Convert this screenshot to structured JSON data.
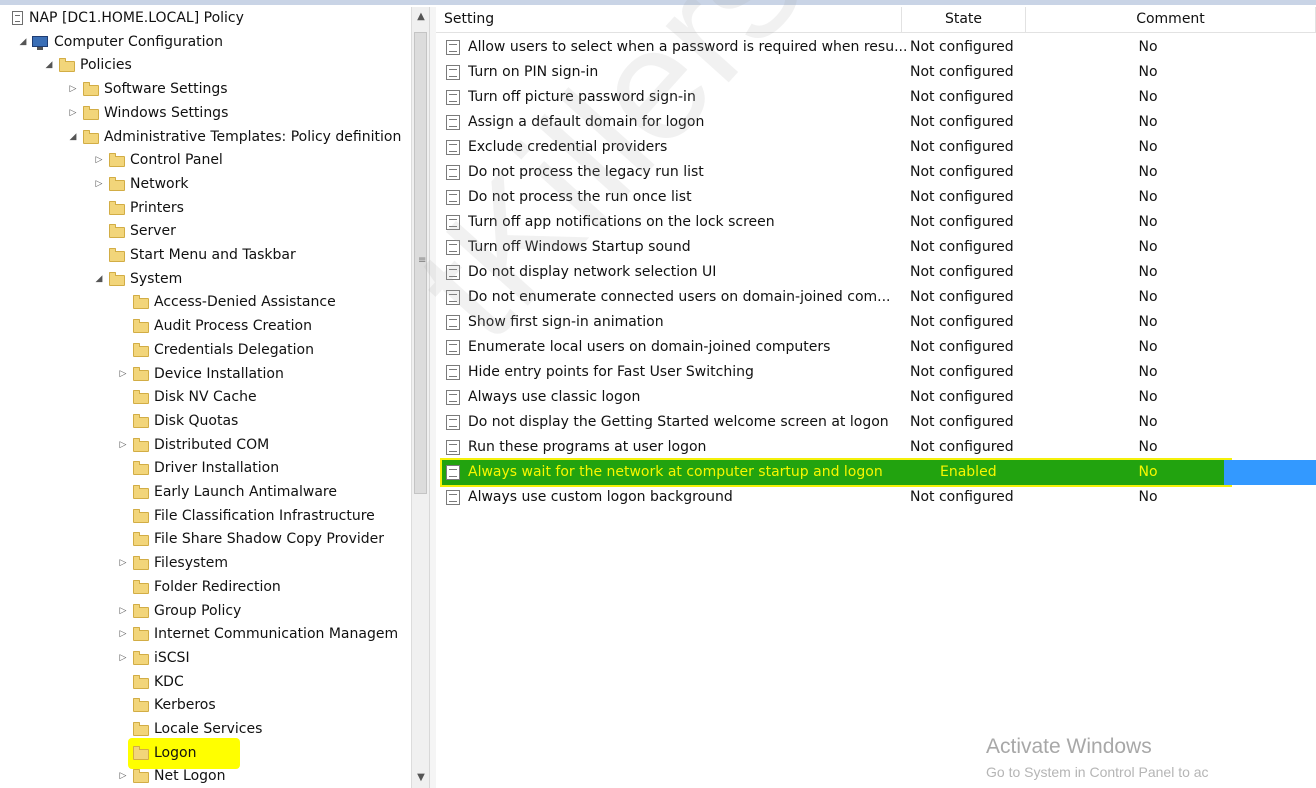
{
  "tree": {
    "root": {
      "label": "NAP [DC1.HOME.LOCAL] Policy",
      "icon": "policy-document-icon"
    },
    "nodes": [
      {
        "label": "Computer Configuration",
        "expander": "expanded",
        "icon": "computer-icon"
      },
      {
        "label": "Policies",
        "expander": "expanded",
        "icon": "folder-icon"
      },
      {
        "label": "Software Settings",
        "expander": "collapsed",
        "icon": "folder-icon"
      },
      {
        "label": "Windows Settings",
        "expander": "collapsed",
        "icon": "folder-icon"
      },
      {
        "label": "Administrative Templates: Policy definition",
        "expander": "expanded",
        "icon": "folder-icon"
      },
      {
        "label": "Control Panel",
        "expander": "collapsed",
        "icon": "folder-icon"
      },
      {
        "label": "Network",
        "expander": "collapsed",
        "icon": "folder-icon"
      },
      {
        "label": "Printers",
        "expander": "none",
        "icon": "folder-icon"
      },
      {
        "label": "Server",
        "expander": "none",
        "icon": "folder-icon"
      },
      {
        "label": "Start Menu and Taskbar",
        "expander": "none",
        "icon": "folder-icon"
      },
      {
        "label": "System",
        "expander": "expanded",
        "icon": "folder-icon"
      },
      {
        "label": "Access-Denied Assistance",
        "expander": "none",
        "icon": "folder-icon"
      },
      {
        "label": "Audit Process Creation",
        "expander": "none",
        "icon": "folder-icon"
      },
      {
        "label": "Credentials Delegation",
        "expander": "none",
        "icon": "folder-icon"
      },
      {
        "label": "Device Installation",
        "expander": "collapsed",
        "icon": "folder-icon"
      },
      {
        "label": "Disk NV Cache",
        "expander": "none",
        "icon": "folder-icon"
      },
      {
        "label": "Disk Quotas",
        "expander": "none",
        "icon": "folder-icon"
      },
      {
        "label": "Distributed COM",
        "expander": "collapsed",
        "icon": "folder-icon"
      },
      {
        "label": "Driver Installation",
        "expander": "none",
        "icon": "folder-icon"
      },
      {
        "label": "Early Launch Antimalware",
        "expander": "none",
        "icon": "folder-icon"
      },
      {
        "label": "File Classification Infrastructure",
        "expander": "none",
        "icon": "folder-icon"
      },
      {
        "label": "File Share Shadow Copy Provider",
        "expander": "none",
        "icon": "folder-icon"
      },
      {
        "label": "Filesystem",
        "expander": "collapsed",
        "icon": "folder-icon"
      },
      {
        "label": "Folder Redirection",
        "expander": "none",
        "icon": "folder-icon"
      },
      {
        "label": "Group Policy",
        "expander": "collapsed",
        "icon": "folder-icon"
      },
      {
        "label": "Internet Communication Managem",
        "expander": "collapsed",
        "icon": "folder-icon"
      },
      {
        "label": "iSCSI",
        "expander": "collapsed",
        "icon": "folder-icon"
      },
      {
        "label": "KDC",
        "expander": "none",
        "icon": "folder-icon"
      },
      {
        "label": "Kerberos",
        "expander": "none",
        "icon": "folder-icon"
      },
      {
        "label": "Locale Services",
        "expander": "none",
        "icon": "folder-icon"
      },
      {
        "label": "Logon",
        "expander": "none",
        "icon": "folder-icon",
        "highlight": "#ffff00"
      },
      {
        "label": "Net Logon",
        "expander": "collapsed",
        "icon": "folder-icon"
      }
    ]
  },
  "list": {
    "columns": [
      "Setting",
      "State",
      "Comment"
    ],
    "rows": [
      {
        "setting": "Allow users to select when a password is required when resu...",
        "state": "Not configured",
        "comment": "No"
      },
      {
        "setting": "Turn on PIN sign-in",
        "state": "Not configured",
        "comment": "No"
      },
      {
        "setting": "Turn off picture password sign-in",
        "state": "Not configured",
        "comment": "No"
      },
      {
        "setting": "Assign a default domain for logon",
        "state": "Not configured",
        "comment": "No"
      },
      {
        "setting": "Exclude credential providers",
        "state": "Not configured",
        "comment": "No"
      },
      {
        "setting": "Do not process the legacy run list",
        "state": "Not configured",
        "comment": "No"
      },
      {
        "setting": "Do not process the run once list",
        "state": "Not configured",
        "comment": "No"
      },
      {
        "setting": "Turn off app notifications on the lock screen",
        "state": "Not configured",
        "comment": "No"
      },
      {
        "setting": "Turn off Windows Startup sound",
        "state": "Not configured",
        "comment": "No"
      },
      {
        "setting": "Do not display network selection UI",
        "state": "Not configured",
        "comment": "No"
      },
      {
        "setting": "Do not enumerate connected users on domain-joined com...",
        "state": "Not configured",
        "comment": "No"
      },
      {
        "setting": "Show first sign-in animation",
        "state": "Not configured",
        "comment": "No"
      },
      {
        "setting": "Enumerate local users on domain-joined computers",
        "state": "Not configured",
        "comment": "No"
      },
      {
        "setting": "Hide entry points for Fast User Switching",
        "state": "Not configured",
        "comment": "No"
      },
      {
        "setting": "Always use classic logon",
        "state": "Not configured",
        "comment": "No"
      },
      {
        "setting": "Do not display the Getting Started welcome screen at logon",
        "state": "Not configured",
        "comment": "No"
      },
      {
        "setting": "Run these programs at user logon",
        "state": "Not configured",
        "comment": "No"
      },
      {
        "setting": "Always wait for the network at computer startup and logon",
        "state": "Enabled",
        "comment": "No",
        "highlighted": true
      },
      {
        "setting": "Always use custom logon background",
        "state": "Not configured",
        "comment": "No"
      }
    ],
    "highlight_colors": {
      "band": "#22a30f",
      "text": "#f7f700",
      "selection": "#3399ff"
    }
  },
  "watermark": "tKillers.net",
  "activation": {
    "title": "Activate Windows",
    "subtitle": "Go to System in Control Panel to ac"
  }
}
